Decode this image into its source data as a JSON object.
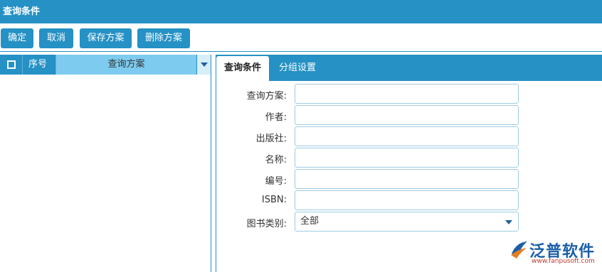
{
  "window": {
    "title": "查询条件"
  },
  "toolbar": {
    "confirm": "确定",
    "cancel": "取消",
    "save_plan": "保存方案",
    "delete_plan": "删除方案"
  },
  "grid": {
    "columns": {
      "seq": "序号",
      "plan": "查询方案"
    },
    "rows": []
  },
  "tabs": {
    "active": "查询条件",
    "group_settings": "分组设置"
  },
  "form": {
    "plan": {
      "label": "查询方案:",
      "value": ""
    },
    "author": {
      "label": "作者:",
      "value": ""
    },
    "publisher": {
      "label": "出版社:",
      "value": ""
    },
    "name": {
      "label": "名称:",
      "value": ""
    },
    "number": {
      "label": "编号:",
      "value": ""
    },
    "isbn": {
      "label": "ISBN:",
      "value": ""
    },
    "category": {
      "label": "图书类别:",
      "value": "全部"
    }
  },
  "logo": {
    "text": "泛普软件",
    "url": "www.fanpusoft.com"
  },
  "colors": {
    "accent": "#2591c5",
    "header_highlight": "#7ecbf0",
    "logo_blue": "#1a5fa8",
    "logo_red": "#c0392b"
  }
}
